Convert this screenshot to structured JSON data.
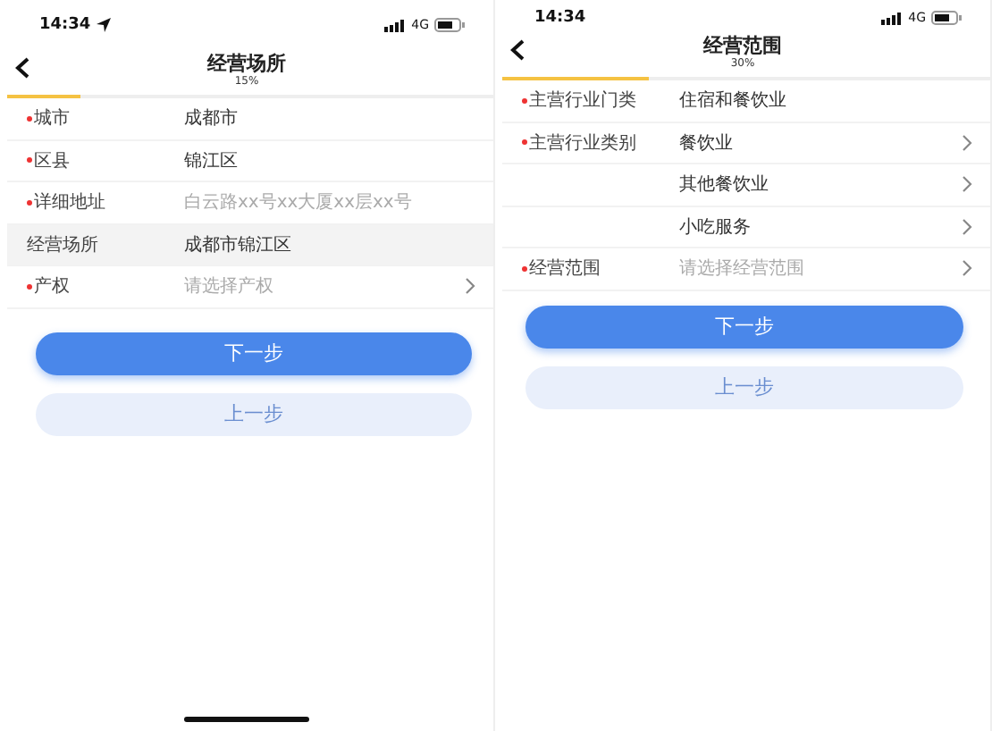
{
  "screens": [
    {
      "status_bar": {
        "time": "14:34",
        "location_arrow": true,
        "network": "4G"
      },
      "header": {
        "title": "经营场所",
        "progress_text": "15%",
        "level": 0.15
      },
      "rows": [
        {
          "label": "城市",
          "required": true,
          "value": "成都市",
          "highlighted": false,
          "has_arrow": false
        },
        {
          "label": "区县",
          "required": true,
          "value": "锦江区",
          "highlighted": false,
          "has_arrow": false
        },
        {
          "label": "详细地址",
          "required": true,
          "placeholder": "白云路xx号xx大厦xx层xx号",
          "highlighted": false,
          "has_arrow": false
        },
        {
          "label": "经营场所",
          "required": false,
          "value": "成都市锦江区",
          "highlighted": true,
          "has_arrow": false
        },
        {
          "label": "产权",
          "required": true,
          "placeholder": "请选择产权",
          "highlighted": false,
          "has_arrow": true
        }
      ],
      "buttons": [
        {
          "label": "下一步",
          "kind": "primary"
        },
        {
          "label": "上一步",
          "kind": "secondary"
        }
      ],
      "home_indicator": true
    },
    {
      "status_bar": {
        "time": "14:34",
        "location_arrow": false,
        "network": "4G"
      },
      "header": {
        "title": "经营范围",
        "progress_text": "30%",
        "level": 0.3
      },
      "rows": [
        {
          "label": "主营行业门类",
          "required": true,
          "value": "住宿和餐饮业",
          "highlighted": false,
          "has_arrow": false
        },
        {
          "label": "主营行业类别",
          "required": true,
          "value": "餐饮业",
          "highlighted": false,
          "has_arrow": true
        },
        {
          "value": "其他餐饮业",
          "highlighted": false,
          "has_arrow": true
        },
        {
          "value": "小吃服务",
          "highlighted": false,
          "has_arrow": true
        },
        {
          "label": "经营范围",
          "required": true,
          "placeholder": "请选择经营范围",
          "highlighted": false,
          "has_arrow": true
        }
      ],
      "buttons": [
        {
          "label": "下一步",
          "kind": "primary"
        },
        {
          "label": "上一步",
          "kind": "secondary"
        }
      ],
      "home_indicator": false
    }
  ]
}
